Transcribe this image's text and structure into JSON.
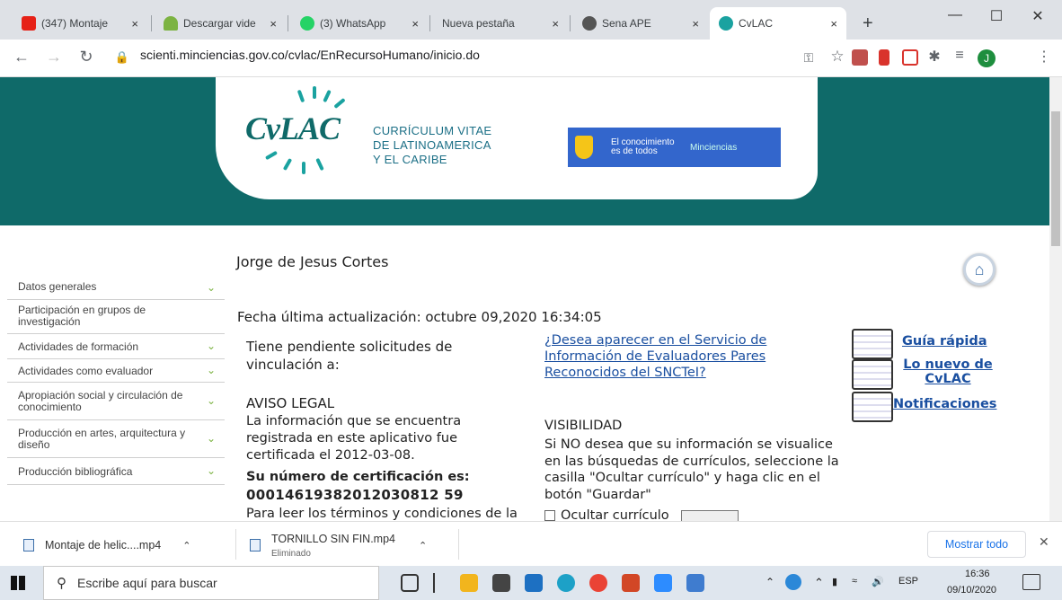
{
  "browser": {
    "tabs": [
      {
        "label": "(347) Montaje",
        "color": "#e62117"
      },
      {
        "label": "Descargar vide",
        "color": "#7cb342"
      },
      {
        "label": "(3) WhatsApp",
        "color": "#25d366"
      },
      {
        "label": "Nueva pestaña",
        "color": ""
      },
      {
        "label": "Sena APE",
        "color": "#555555"
      },
      {
        "label": "CvLAC",
        "color": "#1aa2a0"
      }
    ],
    "new_tab": "+",
    "close_glyph": "×",
    "url": "scienti.minciencias.gov.co/cvlac/EnRecursoHumano/inicio.do",
    "profile_initial": "J"
  },
  "banner": {
    "logo": "CvLAC",
    "logo_line1": "CURRÍCULUM VITAE",
    "logo_line2": "DE LATINOAMERICA",
    "logo_line3": "Y EL CARIBE",
    "gov_tagline": "El conocimiento es de todos",
    "gov_ministry": "Minciencias"
  },
  "profile": {
    "name": "Jorge de Jesus Cortes",
    "updated": "Fecha última actualización: octubre 09,2020 16:34:05"
  },
  "sidebar": {
    "items": [
      {
        "label": "Datos generales"
      },
      {
        "label": "Participación en grupos de investigación"
      },
      {
        "label": "Actividades de formación"
      },
      {
        "label": "Actividades como evaluador"
      },
      {
        "label": "Apropiación social y circulación de conocimiento"
      },
      {
        "label": "Producción en artes, arquitectura y diseño"
      },
      {
        "label": "Producción bibliográfica"
      }
    ]
  },
  "content": {
    "pending": "Tiene pendiente solicitudes de vinculación a:",
    "aviso_title": "AVISO LEGAL",
    "aviso_text": "La información que se encuentra registrada en este aplicativo fue certificada el 2012-03-08.",
    "cert_label": "Su número de certificación es:",
    "cert_number": "00014619382012030812 59",
    "terms": "Para leer los términos y condiciones de la",
    "evaluadores_link": "¿Desea aparecer en el Servicio de Información de Evaluadores Pares Reconocidos del SNCTeI?",
    "vis_title": "VISIBILIDAD",
    "vis_text": "Si NO desea que su información se visualice en las búsquedas de currículos, seleccione la casilla \"Ocultar currículo\" y haga clic en el botón \"Guardar\"",
    "ocultar": "Ocultar currículo"
  },
  "quicklinks": {
    "guia": "Guía rápida",
    "nuevo": "Lo nuevo de CvLAC",
    "notif": "Notificaciones"
  },
  "downloads": {
    "items": [
      {
        "name": "Montaje de helic....mp4",
        "status": ""
      },
      {
        "name": "TORNILLO SIN FIN.mp4",
        "status": "Eliminado"
      }
    ],
    "show_all": "Mostrar todo"
  },
  "taskbar": {
    "search_placeholder": "Escribe aquí para buscar",
    "lang": "ESP",
    "time": "16:36",
    "date": "09/10/2020"
  }
}
